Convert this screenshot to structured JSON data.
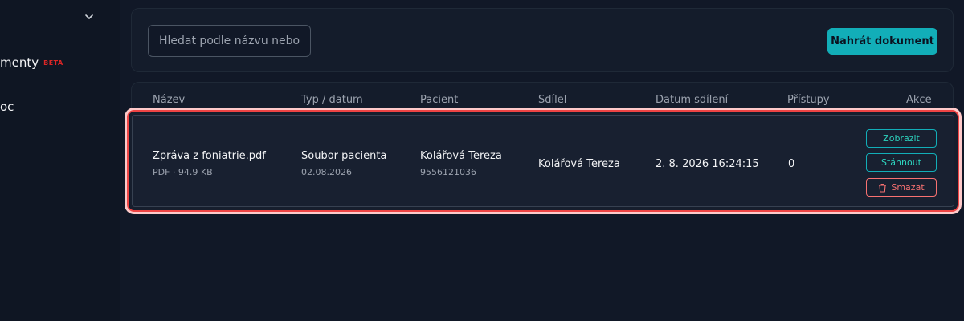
{
  "sidebar": {
    "items": [
      {
        "label": "menty",
        "badge": "BETA"
      },
      {
        "label": "oc"
      }
    ]
  },
  "toolbar": {
    "search_placeholder": "Hledat podle názvu nebo",
    "upload_label": "Nahrát dokument"
  },
  "table": {
    "headers": [
      "Název",
      "Typ / datum",
      "Pacient",
      "Sdílel",
      "Datum sdílení",
      "Přístupy",
      "Akce"
    ],
    "rows": [
      {
        "name": "Zpráva z foniatrie.pdf",
        "file_meta": "PDF · 94.9 KB",
        "type": "Soubor pacienta",
        "type_date": "02.08.2026",
        "patient": "Kolářová Tereza",
        "patient_id": "9556121036",
        "shared_by": "Kolářová Tereza",
        "shared_date": "2. 8. 2026 16:24:15",
        "accesses": "0",
        "actions": {
          "view": "Zobrazit",
          "download": "Stáhnout",
          "delete": "Smazat"
        }
      }
    ]
  },
  "colors": {
    "accent": "#12aeb8",
    "danger": "#f87171",
    "highlight": "#ef4444"
  }
}
